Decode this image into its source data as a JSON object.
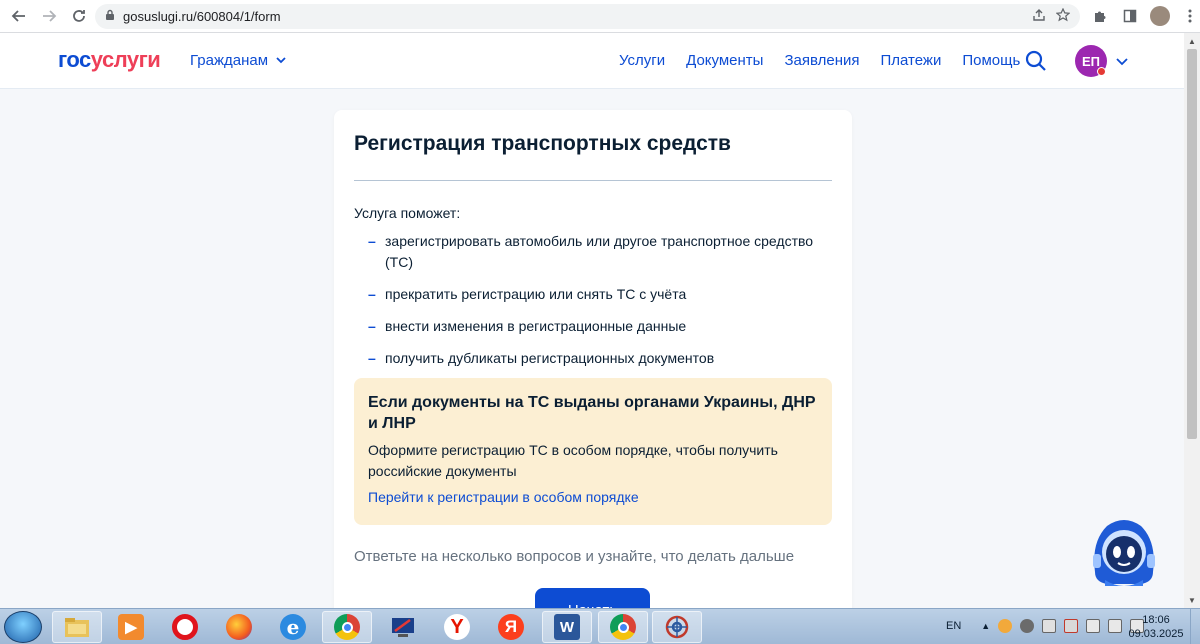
{
  "browser": {
    "url": "gosuslugi.ru/600804/1/form"
  },
  "site": {
    "logo_part1": "гос",
    "logo_part2": "услуги",
    "audience_menu": "Гражданам",
    "nav": [
      "Услуги",
      "Документы",
      "Заявления",
      "Платежи",
      "Помощь"
    ],
    "avatar_initials": "ЕП"
  },
  "form": {
    "title": "Регистрация транспортных средств",
    "intro": "Услуга поможет:",
    "benefits": [
      "зарегистрировать автомобиль или другое транспортное средство (ТС)",
      "прекратить регистрацию или снять ТС с учёта",
      "внести изменения в регистрационные данные",
      "получить дубликаты регистрационных документов"
    ],
    "alert": {
      "title": "Если документы на ТС выданы органами Украины, ДНР и ЛНР",
      "text": "Оформите регистрацию ТС в особом порядке, чтобы получить российские документы",
      "link": "Перейти к регистрации в особом порядке"
    },
    "hint": "Ответьте на несколько вопросов и узнайте, что делать дальше",
    "start_button": "Начать"
  },
  "taskbar": {
    "language": "EN",
    "time": "18:06",
    "date": "09.03.2025",
    "apps": [
      "file-explorer-icon",
      "media-player-icon",
      "opera-icon",
      "firefox-icon",
      "internet-explorer-icon",
      "chrome-icon",
      "screen-tool-icon",
      "yandex-browser-icon",
      "yandex-icon",
      "word-icon",
      "chrome-icon",
      "network-app-icon"
    ]
  },
  "colors": {
    "brand_blue": "#0d4cd3",
    "brand_red": "#ee3f58",
    "alert_bg": "#fcefd3",
    "avatar_bg": "#9c27b0"
  }
}
